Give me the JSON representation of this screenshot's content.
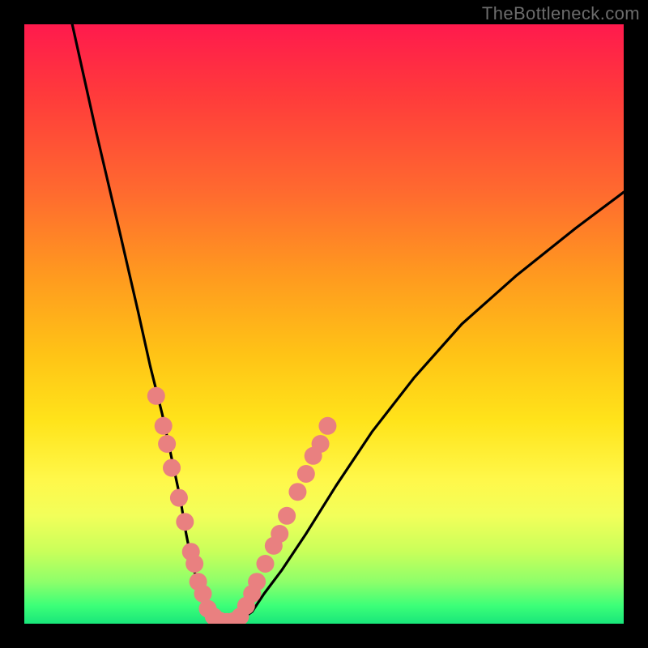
{
  "watermark": "TheBottleneck.com",
  "chart_data": {
    "type": "line",
    "title": "",
    "xlabel": "",
    "ylabel": "",
    "xlim": [
      0,
      100
    ],
    "ylim": [
      0,
      100
    ],
    "grid": false,
    "series": [
      {
        "name": "bottleneck-curve",
        "x": [
          8,
          12,
          16,
          19,
          21,
          23,
          24.5,
          26,
          27,
          28,
          29.2,
          30.5,
          32,
          34,
          36,
          38,
          40,
          43,
          47,
          52,
          58,
          65,
          73,
          82,
          92,
          100
        ],
        "y": [
          100,
          82,
          65,
          52,
          43,
          35,
          28,
          21,
          15,
          10,
          6,
          3,
          1,
          0.3,
          0.6,
          2,
          5,
          9,
          15,
          23,
          32,
          41,
          50,
          58,
          66,
          72
        ]
      }
    ],
    "markers": {
      "name": "highlight-dots",
      "color_hex": "#e98080",
      "points": [
        {
          "x": 22.0,
          "y": 38
        },
        {
          "x": 23.2,
          "y": 33
        },
        {
          "x": 23.8,
          "y": 30
        },
        {
          "x": 24.6,
          "y": 26
        },
        {
          "x": 25.8,
          "y": 21
        },
        {
          "x": 26.8,
          "y": 17
        },
        {
          "x": 27.8,
          "y": 12
        },
        {
          "x": 28.4,
          "y": 10
        },
        {
          "x": 29.0,
          "y": 7
        },
        {
          "x": 29.8,
          "y": 5
        },
        {
          "x": 30.6,
          "y": 2.5
        },
        {
          "x": 31.6,
          "y": 1.2
        },
        {
          "x": 32.6,
          "y": 0.5
        },
        {
          "x": 33.8,
          "y": 0.3
        },
        {
          "x": 34.8,
          "y": 0.4
        },
        {
          "x": 36.0,
          "y": 1.2
        },
        {
          "x": 37.0,
          "y": 3
        },
        {
          "x": 38.0,
          "y": 5
        },
        {
          "x": 38.8,
          "y": 7
        },
        {
          "x": 40.2,
          "y": 10
        },
        {
          "x": 41.6,
          "y": 13
        },
        {
          "x": 42.6,
          "y": 15
        },
        {
          "x": 43.8,
          "y": 18
        },
        {
          "x": 45.6,
          "y": 22
        },
        {
          "x": 47.0,
          "y": 25
        },
        {
          "x": 48.2,
          "y": 28
        },
        {
          "x": 49.4,
          "y": 30
        },
        {
          "x": 50.6,
          "y": 33
        }
      ]
    },
    "background_gradient": {
      "stops": [
        {
          "pos": 0,
          "color": "#ff1a4d"
        },
        {
          "pos": 0.5,
          "color": "#ffc316"
        },
        {
          "pos": 0.82,
          "color": "#f2ff5a"
        },
        {
          "pos": 1.0,
          "color": "#19e67a"
        }
      ]
    }
  }
}
